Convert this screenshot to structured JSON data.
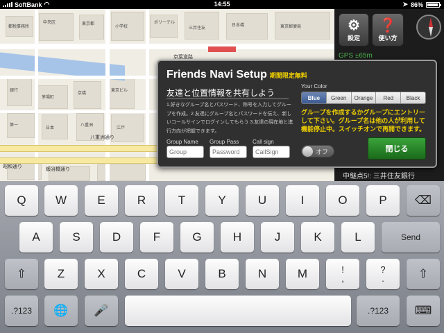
{
  "status_bar": {
    "carrier": "SoftBank",
    "time": "14:55",
    "battery": "86%"
  },
  "map": {
    "labels": [
      "都税事務所",
      "中央区",
      "東京都",
      "小学校",
      "ポリーテル",
      "三井住友",
      "日本橋",
      "東京郵便局",
      "銀行",
      "茅場町",
      "京橋",
      "東京ビル",
      "第一",
      "日本",
      "八重洲",
      "江戸"
    ],
    "streets": [
      "昭和通り",
      "鍛冶橋通り",
      "八重洲通り",
      "京葉道路"
    ]
  },
  "right_panel": {
    "settings_label": "設定",
    "help_label": "使い方",
    "gps": "GPS ±65m",
    "destination": "中継点5!: 三井住友銀行"
  },
  "dialog": {
    "title": "Friends Navi Setup",
    "promo": "期間限定無料",
    "subtitle": "友達と位置情報を共有しよう",
    "description": "1.好きなグループ名とパスワード、称号を入力してグループを作成。2.友達にグループ名とパスワードを伝え、新しいコールサインでログインしてもらう 3.友達の現在地と進行方向が把握できます。",
    "group_name_label": "Group Name",
    "group_name_placeholder": "Group",
    "group_pass_label": "Group Pass",
    "group_pass_placeholder": "Password",
    "call_sign_label": "Call sign",
    "call_sign_placeholder": "CallSign",
    "your_color_label": "Your Color",
    "color_options": [
      "Blue",
      "Green",
      "Orange",
      "Red",
      "Black"
    ],
    "selected_color": "Blue",
    "notice": "グループを作成するかグループにエントリーして下さい。グループ名は他の人が利用して機能停止中。スイッチオンで再開できます。",
    "toggle_label": "オフ",
    "close_button": "閉じる"
  },
  "keyboard": {
    "row1": [
      "Q",
      "W",
      "E",
      "R",
      "T",
      "Y",
      "U",
      "I",
      "O",
      "P"
    ],
    "row2": [
      "A",
      "S",
      "D",
      "F",
      "G",
      "H",
      "J",
      "K",
      "L"
    ],
    "row3": [
      "Z",
      "X",
      "C",
      "V",
      "B",
      "N",
      "M"
    ],
    "send": "Send",
    "numbers": ".?123",
    "exclaim_top": "!",
    "exclaim_bottom": ",",
    "question_top": "?",
    "question_bottom": "."
  }
}
